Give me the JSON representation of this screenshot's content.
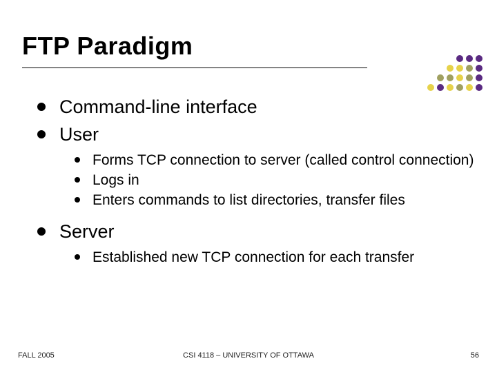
{
  "title": "FTP Paradigm",
  "bullets": {
    "b0": {
      "text": "Command-line interface"
    },
    "b1": {
      "text": "User"
    },
    "b1s": {
      "s0": "Forms TCP connection to server (called control connection)",
      "s1": "Logs in",
      "s2": "Enters commands to list directories, transfer files"
    },
    "b2": {
      "text": "Server"
    },
    "b2s": {
      "s0": "Established new TCP connection for each transfer"
    }
  },
  "footer": {
    "left": "FALL 2005",
    "center": "CSI 4118 – UNIVERSITY OF OTTAWA",
    "right": "56"
  },
  "decor_colors": {
    "purple": "#5a2a82",
    "yellow": "#e6d24a",
    "olive": "#a0a060"
  }
}
